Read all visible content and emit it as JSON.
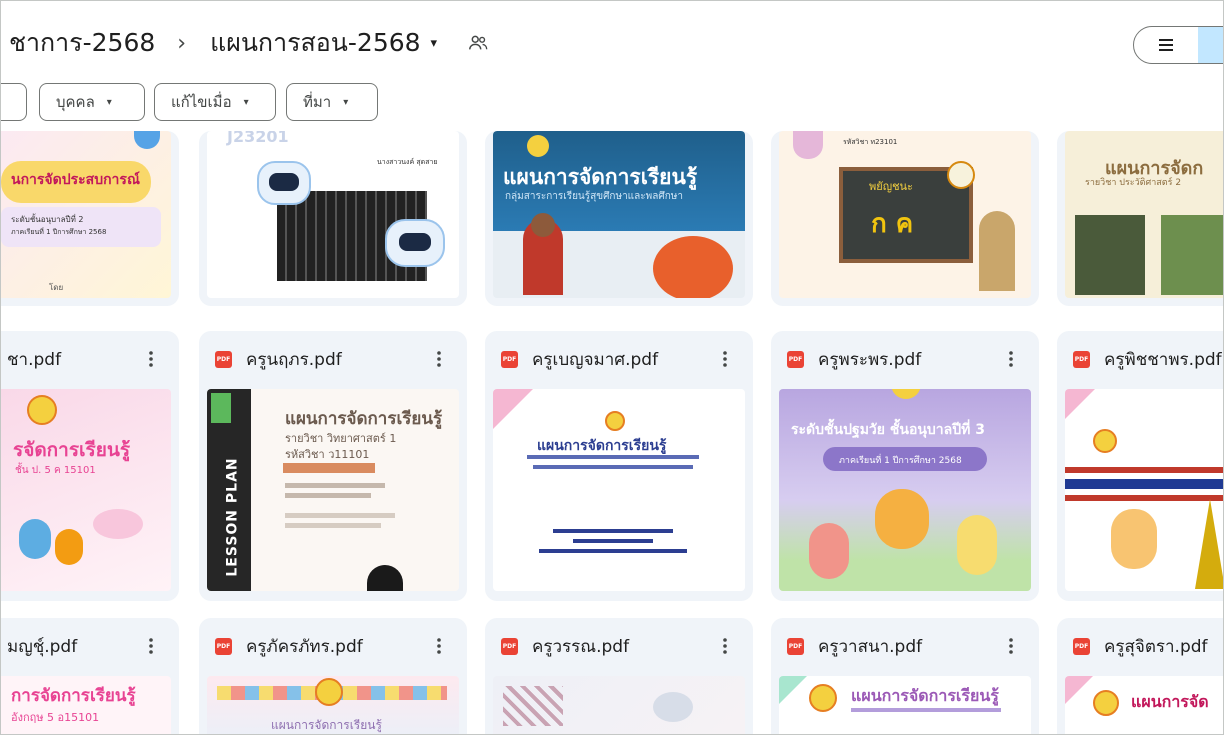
{
  "breadcrumb": {
    "previous": "ชาการ-2568",
    "separator": "›",
    "current": "แผนการสอน-2568",
    "caret": "▾"
  },
  "filters": [
    {
      "label": "บุคคล"
    },
    {
      "label": "แก้ไขเมื่อ"
    },
    {
      "label": "ที่มา"
    }
  ],
  "filter_caret": "▾",
  "pdf_badge": "PDF",
  "files_row2": [
    {
      "name": "ชา.pdf"
    },
    {
      "name": "ครูนฤภร.pdf"
    },
    {
      "name": "ครูเบญจมาศ.pdf"
    },
    {
      "name": "ครูพระพร.pdf"
    },
    {
      "name": "ครูพิชชาพร.pdf"
    }
  ],
  "files_row3": [
    {
      "name": "มญชุ์.pdf"
    },
    {
      "name": "ครูภัครภัทร.pdf"
    },
    {
      "name": "ครูวรรณ.pdf"
    },
    {
      "name": "ครูวาสนา.pdf"
    },
    {
      "name": "ครูสุจิตรา.pdf"
    }
  ],
  "thumbs": {
    "r1c1_title": "นการจัดประสบการณ์",
    "r1c1_sub1": "ระดับชั้นอนุบาลปีที่ 2",
    "r1c1_sub2": "ภาคเรียนที่ 1 ปีการศึกษา 2568",
    "r1c1_sub3": "โดย",
    "r1c2_top": "J23201",
    "r1c3_title": "แผนการจัดการเรียนรู้",
    "r1c3_sub": "กลุ่มสาระการเรียนรู้สุขศึกษาและพลศึกษา",
    "r1c4_word": "พยัญชนะ",
    "r1c4_letters": "ก ค",
    "r1c5_title": "แผนการจัดก",
    "r1c5_sub": "รายวิชา ประวัติศาสตร์ 2",
    "r2c1_title": "รจัดการเรียนรู้",
    "r2c1_sub": "ชั้น ป. 5  ค 15101",
    "r2c2_title": "แผนการจัดการเรียนรู้",
    "r2c2_sub1": "รายวิชา วิทยาศาสตร์ 1",
    "r2c2_sub2": "รหัสวิชา ว11101",
    "r2c2_side": "LESSON PLAN",
    "r2c3_title": "แผนการจัดการเรียนรู้",
    "r2c4_title": "ระดับชั้นปฐมวัย ชั้นอนุบาลปีที่ 3",
    "r2c4_sub": "ภาคเรียนที่ 1 ปีการศึกษา 2568",
    "r3c1_title": "การจัดการเรียนรู้",
    "r3c1_sub": "อังกฤษ 5  อ15101",
    "r3c4_title": "แผนการจัดการเรียนรู้",
    "r3c5_title": "แผนการจัด"
  },
  "colors": {
    "card_bg": "#f0f4f9",
    "pdf_red": "#ea4335",
    "toggle_active": "#c2e7ff"
  }
}
